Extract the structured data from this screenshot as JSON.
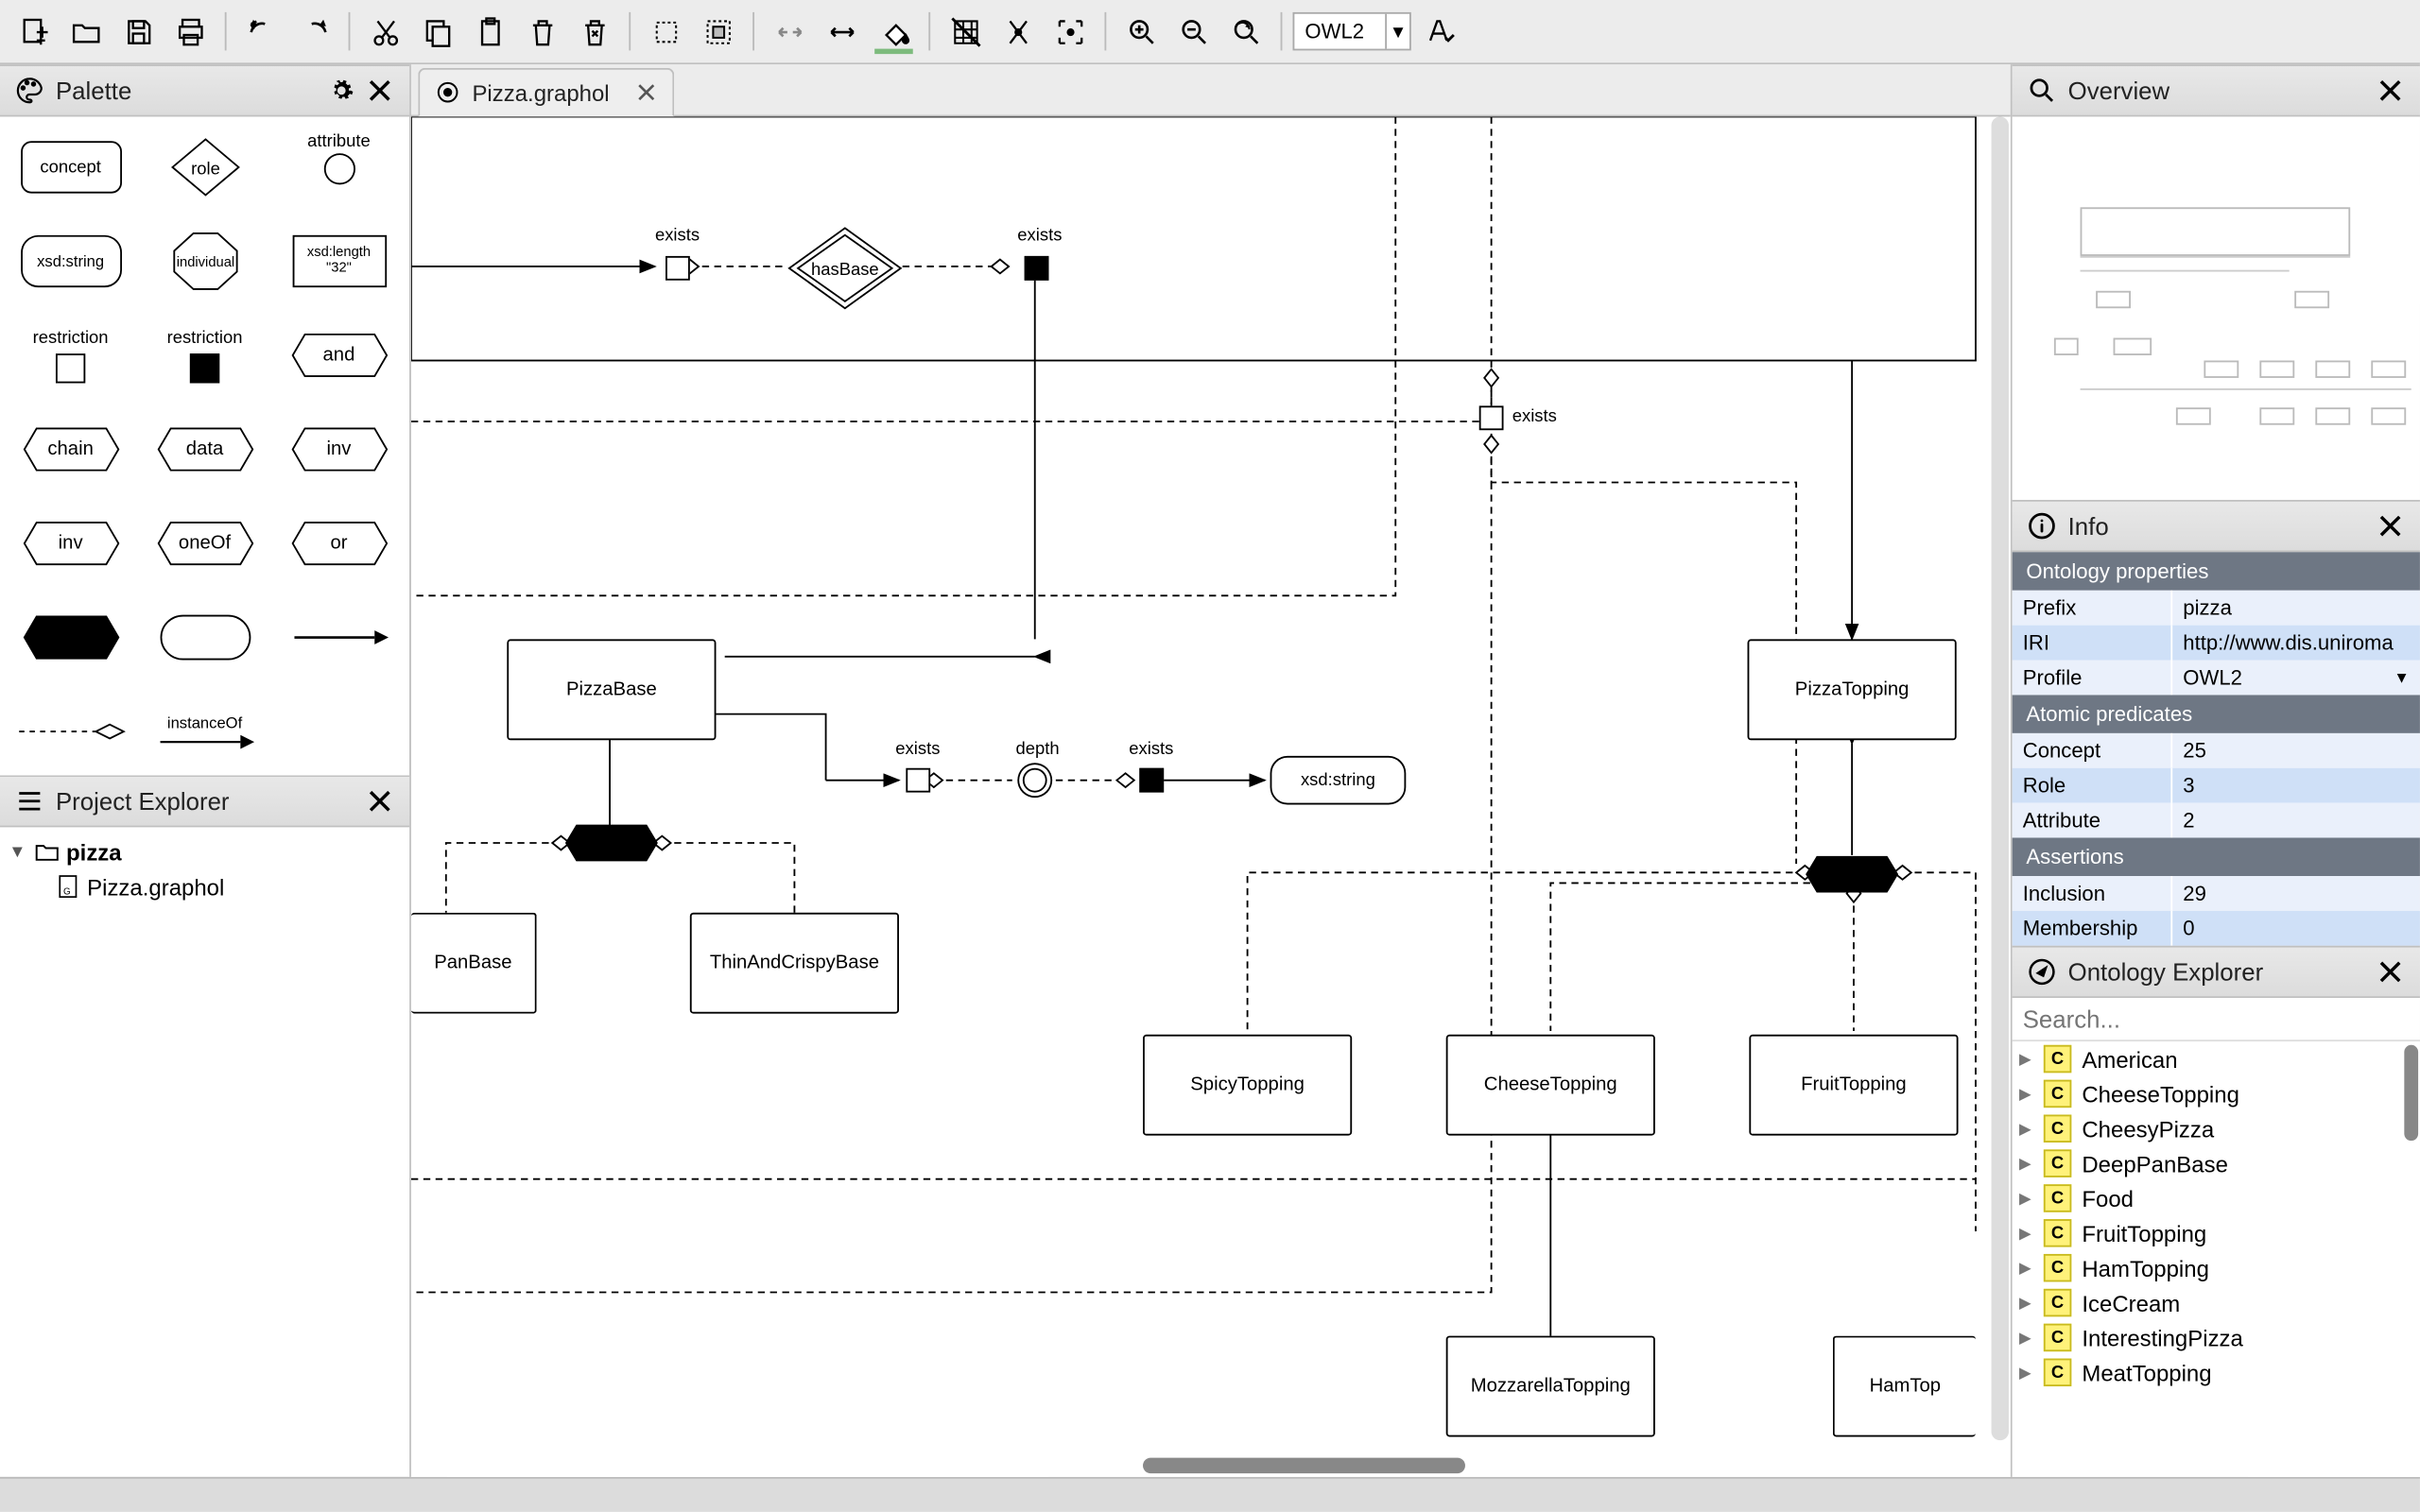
{
  "toolbar": {
    "profile": "OWL2"
  },
  "palette": {
    "title": "Palette",
    "concept": "concept",
    "role": "role",
    "attribute_label": "attribute",
    "xsdstring": "xsd:string",
    "individual": "individual",
    "datatype1": "xsd:length",
    "datatype2": "\"32\"",
    "restriction_white": "restriction",
    "restriction_black": "restriction",
    "and": "and",
    "chain": "chain",
    "data": "data",
    "inv1": "inv",
    "inv2": "inv",
    "oneOf": "oneOf",
    "or": "or",
    "instanceOf": "instanceOf"
  },
  "explorer": {
    "title": "Project Explorer",
    "project": "pizza",
    "file": "Pizza.graphol"
  },
  "tab": {
    "title": "Pizza.graphol"
  },
  "diagram": {
    "hasBase": "hasBase",
    "exists1": "exists",
    "exists2": "exists",
    "exists3": "exists",
    "pizzaBase": "PizzaBase",
    "pizzaTopping": "PizzaTopping",
    "panBase": "PanBase",
    "thinAndCrispyBase": "ThinAndCrispyBase",
    "depthExists1": "exists",
    "depth": "depth",
    "depthExists2": "exists",
    "xsdstring": "xsd:string",
    "spicyTopping": "SpicyTopping",
    "cheeseTopping": "CheeseTopping",
    "fruitTopping": "FruitTopping",
    "mozzarellaTopping": "MozzarellaTopping",
    "hamTopping": "HamTop"
  },
  "overview": {
    "title": "Overview"
  },
  "info": {
    "title": "Info",
    "section_ont": "Ontology properties",
    "prefix_k": "Prefix",
    "prefix_v": "pizza",
    "iri_k": "IRI",
    "iri_v": "http://www.dis.uniroma",
    "profile_k": "Profile",
    "profile_v": "OWL2",
    "section_atom": "Atomic predicates",
    "concept_k": "Concept",
    "concept_v": "25",
    "role_k": "Role",
    "role_v": "3",
    "attribute_k": "Attribute",
    "attribute_v": "2",
    "section_assert": "Assertions",
    "inclusion_k": "Inclusion",
    "inclusion_v": "29",
    "membership_k": "Membership",
    "membership_v": "0"
  },
  "ontExplorer": {
    "title": "Ontology Explorer",
    "search_placeholder": "Search...",
    "items": [
      "American",
      "CheeseTopping",
      "CheesyPizza",
      "DeepPanBase",
      "Food",
      "FruitTopping",
      "HamTopping",
      "IceCream",
      "InterestingPizza",
      "MeatTopping"
    ]
  }
}
